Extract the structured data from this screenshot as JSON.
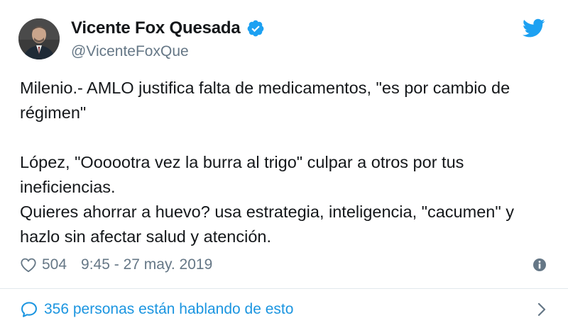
{
  "user": {
    "display_name": "Vicente Fox Quesada",
    "handle": "@VicenteFoxQue",
    "verified": true,
    "avatar_icon": "profile-photo"
  },
  "tweet": {
    "paragraph_1": "Milenio.- AMLO justifica falta de medicamentos, \"es por cambio de régimen\"",
    "paragraph_2": "López, \"Oooootra vez la burra al trigo\" culpar a otros por tus ineficiencias.\nQuieres ahorrar a huevo? usa estrategia, inteligencia, \"cacumen\" y hazlo sin afectar salud y atención."
  },
  "meta": {
    "likes": "504",
    "timestamp": "9:45 - 27 may. 2019"
  },
  "conversation": {
    "label": "356 personas están hablando de esto"
  },
  "icons": {
    "brand": "twitter-bird-icon",
    "verified": "verified-badge-icon",
    "like": "heart-outline-icon",
    "info": "info-circle-icon",
    "conversation": "speech-bubble-icon",
    "more": "chevron-right-icon"
  },
  "colors": {
    "twitter_blue": "#1da1f2",
    "link_blue": "#1b95e0",
    "text_primary": "#14171a",
    "text_secondary": "#657786",
    "divider": "#e1e8ed"
  }
}
